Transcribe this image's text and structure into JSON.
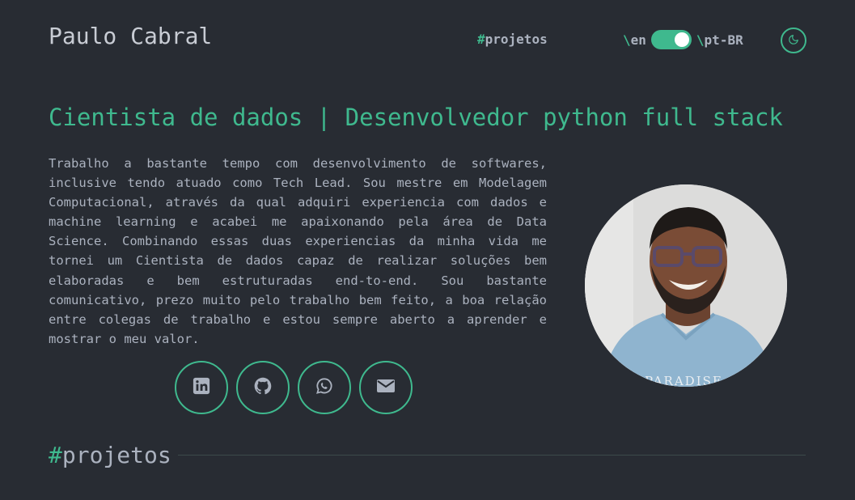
{
  "header": {
    "brand": "Paulo Cabral",
    "nav": {
      "hash": "#",
      "label": "projetos"
    },
    "language": {
      "slash_left": "\\",
      "left": "en",
      "slash_right": "\\",
      "right": "pt-BR"
    },
    "theme_icon": "moon-icon"
  },
  "hero": {
    "headline": "Cientista de dados | Desenvolvedor python full stack",
    "bio": "Trabalho a bastante tempo com desenvolvimento de softwares, inclusive tendo atuado como Tech Lead. Sou mestre em Modelagem Computacional, através da qual adquiri experiencia com dados e machine learning e acabei me apaixonando pela área de Data Science. Combinando essas duas experiencias da minha vida me tornei um Cientista de dados capaz de realizar soluções bem elaboradas e bem estruturadas end-to-end. Sou bastante comunicativo, prezo muito pelo trabalho bem feito, a boa relação entre colegas de trabalho e estou sempre aberto a aprender e mostrar o meu valor.",
    "socials": [
      "linkedin-icon",
      "github-icon",
      "whatsapp-icon",
      "email-icon"
    ],
    "shirt_text": "PARADISE"
  },
  "section": {
    "hash": "#",
    "title": "projetos"
  },
  "colors": {
    "background": "#282c33",
    "accent": "#3fb98e",
    "text": "#abb2bf"
  }
}
